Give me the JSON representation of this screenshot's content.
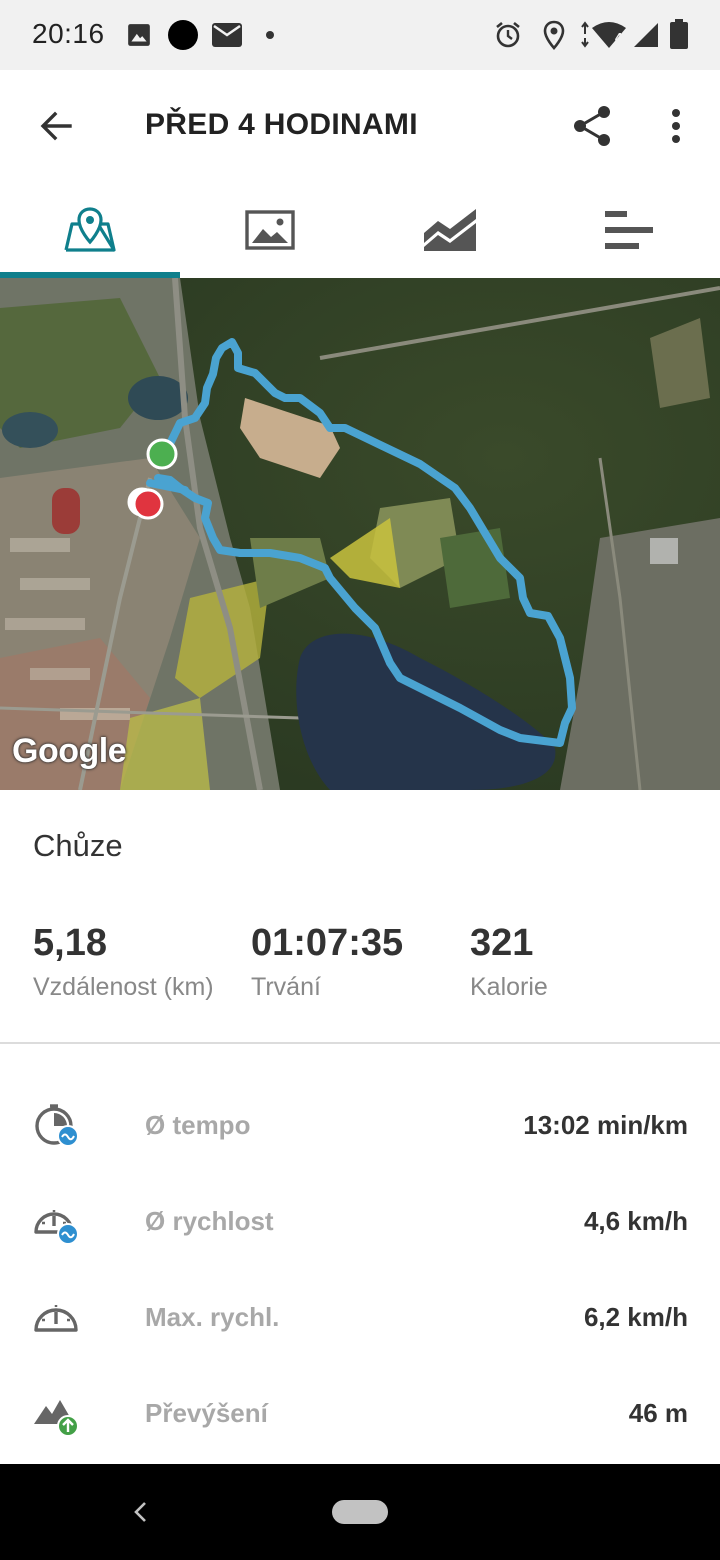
{
  "status_bar": {
    "time": "20:16",
    "left_icons": [
      "image-icon",
      "circle-icon",
      "mail-icon",
      "dot-icon"
    ],
    "right_icons": [
      "alarm-icon",
      "location-icon",
      "wifi-icon",
      "signal-icon",
      "battery-icon"
    ],
    "wifi_badge": "4"
  },
  "header": {
    "title": "PŘED 4 HODINAMI",
    "back_icon": "arrow-back-icon",
    "share_icon": "share-icon",
    "more_icon": "more-vert-icon"
  },
  "tabs": [
    {
      "icon": "map-pin-icon",
      "active": true
    },
    {
      "icon": "image-icon",
      "active": false
    },
    {
      "icon": "chart-icon",
      "active": false
    },
    {
      "icon": "bars-icon",
      "active": false
    }
  ],
  "accent_color": "#0f7f8c",
  "route_color": "#4aa3d1",
  "map": {
    "attribution": "Google",
    "start_marker_color": "#4caf50",
    "end_marker_color": "#e0343f"
  },
  "activity": {
    "type": "Chůze"
  },
  "summary": {
    "distance_value": "5,18",
    "distance_label": "Vzdálenost (km)",
    "duration_value": "01:07:35",
    "duration_label": "Trvání",
    "calories_value": "321",
    "calories_label": "Kalorie"
  },
  "stats": [
    {
      "icon": "pace-icon",
      "label": "Ø tempo",
      "value": "13:02 min/km"
    },
    {
      "icon": "speed-avg-icon",
      "label": "Ø rychlost",
      "value": "4,6 km/h"
    },
    {
      "icon": "speed-max-icon",
      "label": "Max. rychl.",
      "value": "6,2 km/h"
    },
    {
      "icon": "elevation-icon",
      "label": "Převýšení",
      "value": "46 m"
    }
  ]
}
